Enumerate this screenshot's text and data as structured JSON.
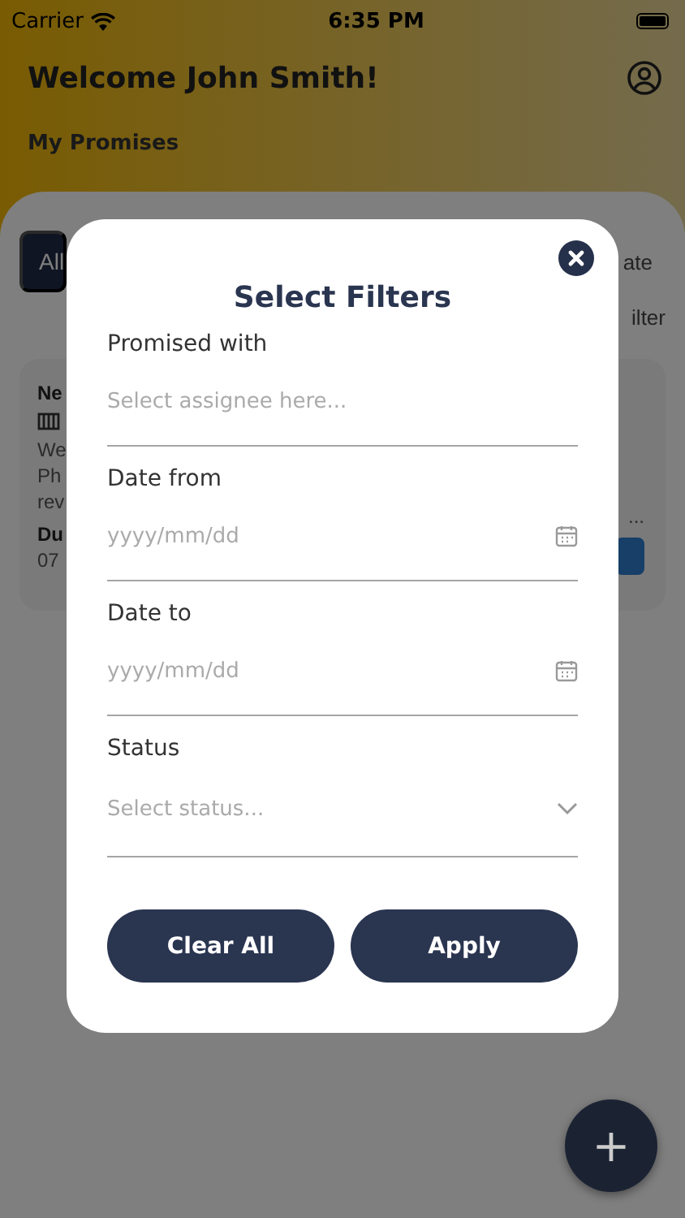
{
  "status_bar": {
    "carrier": "Carrier",
    "time": "6:35 PM"
  },
  "header": {
    "title": "Welcome John Smith!",
    "subtitle": "My Promises"
  },
  "background": {
    "chip": "All",
    "sort_fragment": "ate",
    "filter_fragment": "ilter",
    "card": {
      "title": "Ne",
      "lines": [
        "We",
        "Ph",
        "rev"
      ],
      "due_label": "Du",
      "due_value": "07",
      "ellipsis": "..."
    }
  },
  "modal": {
    "title": "Select Filters",
    "fields": [
      {
        "kind": "text",
        "label": "Promised with",
        "placeholder": "Select assignee here..."
      },
      {
        "kind": "date",
        "label": "Date from",
        "placeholder": "yyyy/mm/dd"
      },
      {
        "kind": "date",
        "label": "Date to",
        "placeholder": "yyyy/mm/dd"
      },
      {
        "kind": "select",
        "label": "Status",
        "placeholder": "Select status..."
      }
    ],
    "buttons": [
      "Clear All",
      "Apply"
    ]
  },
  "fab": "+"
}
